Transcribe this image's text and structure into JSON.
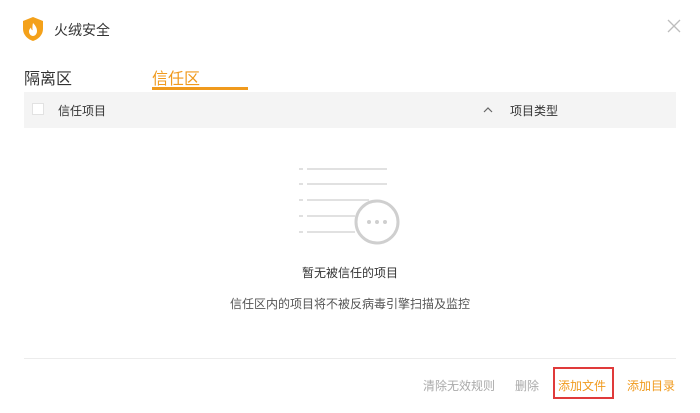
{
  "app": {
    "title": "火绒安全",
    "logo_icon": "huorong-shield-logo",
    "close_icon": "close-icon"
  },
  "tabs": [
    {
      "label": "隔离区",
      "active": false
    },
    {
      "label": "信任区",
      "active": true
    }
  ],
  "table": {
    "columns": [
      {
        "label": "信任项目"
      },
      {
        "label": "项目类型"
      }
    ],
    "sort_icon": "chevron-up-icon"
  },
  "empty_state": {
    "title": "暂无被信任的项目",
    "description": "信任区内的项目将不被反病毒引擎扫描及监控"
  },
  "footer": {
    "clear_invalid": "清除无效规则",
    "delete": "删除",
    "add_file": "添加文件",
    "add_directory": "添加目录"
  },
  "colors": {
    "accent": "#f09a1d",
    "disabled_text": "#aaaaaa",
    "highlight_border": "#e03a3a",
    "header_bg": "#f4f4f4"
  }
}
